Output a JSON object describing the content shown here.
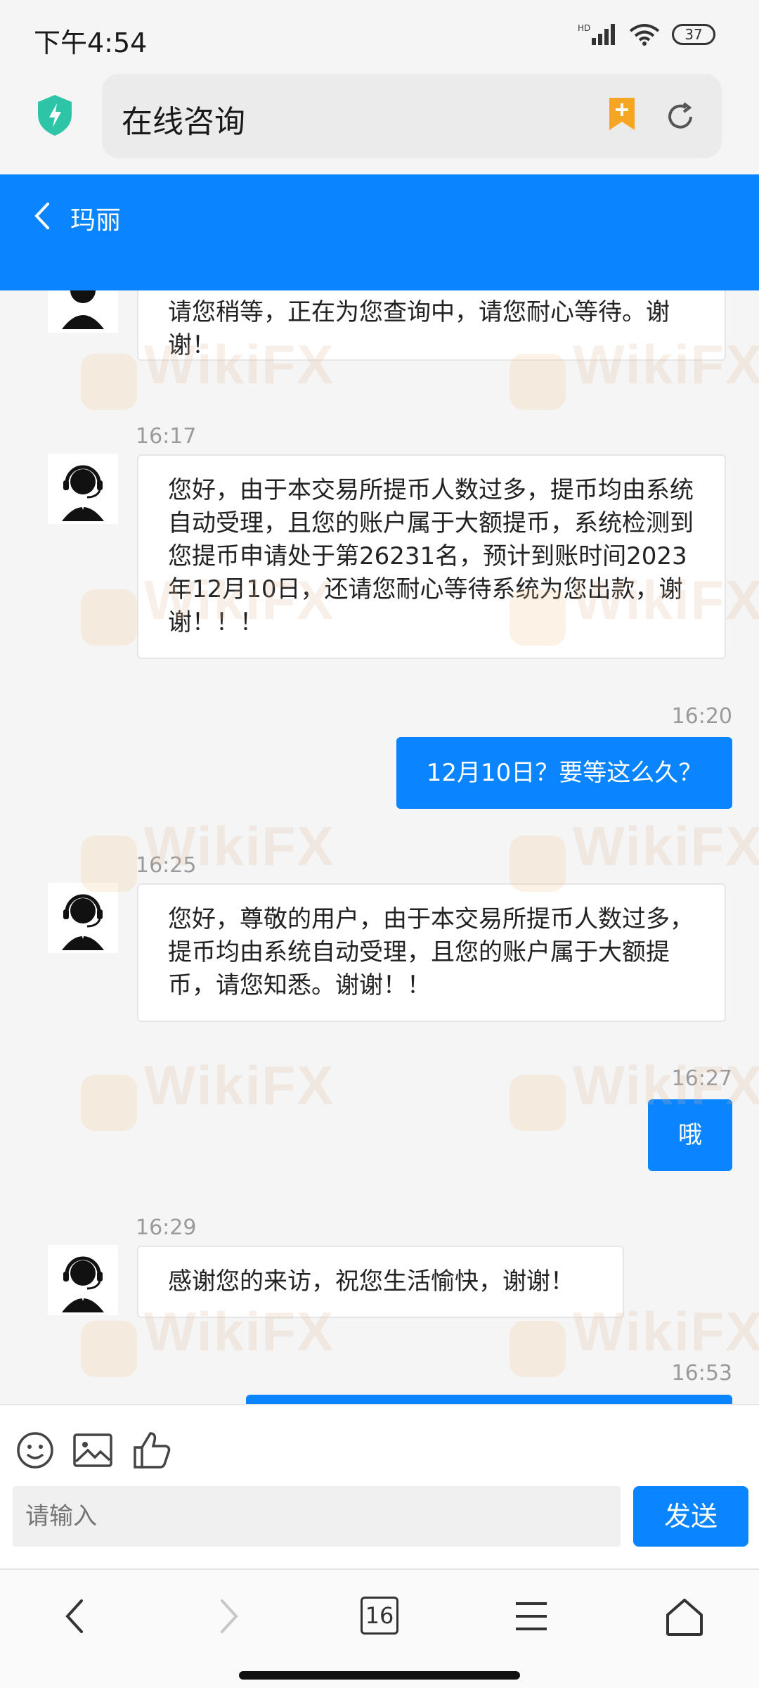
{
  "status_bar": {
    "time": "下午4:54",
    "battery": "37",
    "network": "HD"
  },
  "browser": {
    "title": "在线咨询",
    "tab_count": "16"
  },
  "header": {
    "agent_name": "玛丽"
  },
  "messages": [
    {
      "from": "agent",
      "time": "",
      "text": "请您稍等，正在为您查询中，请您耐心等待。谢谢！"
    },
    {
      "from": "agent",
      "time": "16:17",
      "text": "您好，由于本交易所提币人数过多，提币均由系统自动受理，且您的账户属于大额提币，系统检测到您提币申请处于第26231名，预计到账时间2023年12月10日，还请您耐心等待系统为您出款，谢谢！！！"
    },
    {
      "from": "user",
      "time": "16:20",
      "text": "12月10日？要等这么久？"
    },
    {
      "from": "agent",
      "time": "16:25",
      "text": "您好，尊敬的用户，由于本交易所提币人数过多，提币均由系统自动受理，且您的账户属于大额提币，请您知悉。谢谢！！"
    },
    {
      "from": "user",
      "time": "16:27",
      "text": "哦"
    },
    {
      "from": "agent",
      "time": "16:29",
      "text": "感谢您的来访，祝您生活愉快，谢谢！"
    },
    {
      "from": "user",
      "time": "16:53",
      "text": ""
    }
  ],
  "input": {
    "placeholder": "请输入",
    "send_label": "发送"
  },
  "watermark": "WikiFX",
  "colors": {
    "accent": "#0a84ff",
    "background": "#f5f5f5"
  }
}
